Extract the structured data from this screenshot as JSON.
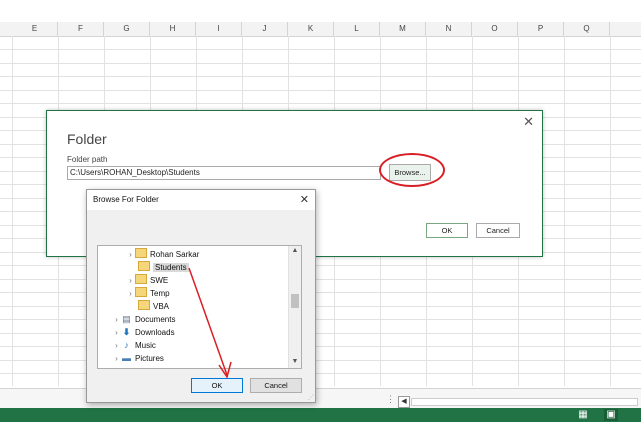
{
  "sheet": {
    "columns": [
      "E",
      "F",
      "G",
      "H",
      "I",
      "J",
      "K",
      "L",
      "M",
      "N",
      "O",
      "P",
      "Q"
    ]
  },
  "folder_dialog": {
    "title": "Folder",
    "path_label": "Folder path",
    "path_value": "C:\\Users\\ROHAN_Desktop\\Students",
    "browse_label": "Browse...",
    "ok_label": "OK",
    "cancel_label": "Cancel",
    "close_glyph": "✕"
  },
  "browse_dialog": {
    "title": "Browse For Folder",
    "close_glyph": "✕",
    "ok_label": "OK",
    "cancel_label": "Cancel",
    "tree": [
      {
        "label": "Rohan Sarkar",
        "icon": "folder-icon",
        "expander": "›"
      },
      {
        "label": "Students",
        "icon": "folder-icon",
        "expander": "",
        "selected": true
      },
      {
        "label": "SWE",
        "icon": "folder-icon",
        "expander": "›"
      },
      {
        "label": "Temp",
        "icon": "folder-icon",
        "expander": "›"
      },
      {
        "label": "VBA",
        "icon": "folder-icon",
        "expander": ""
      },
      {
        "label": "Documents",
        "icon": "document-icon",
        "expander": "›"
      },
      {
        "label": "Downloads",
        "icon": "download-icon",
        "expander": "›"
      },
      {
        "label": "Music",
        "icon": "music-icon",
        "expander": "›"
      },
      {
        "label": "Pictures",
        "icon": "pictures-icon",
        "expander": "›"
      }
    ]
  },
  "colors": {
    "excel_green": "#217346",
    "annotation_red": "#d81f26",
    "folder_yellow": "#f6d67a"
  }
}
